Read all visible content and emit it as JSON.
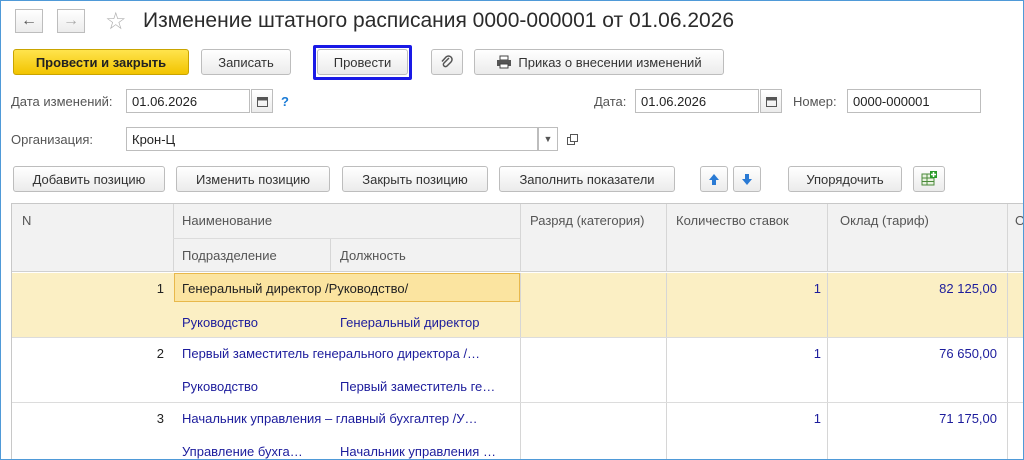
{
  "window": {
    "title": "Изменение штатного расписания 0000-000001 от 01.06.2026",
    "nav_back": "←",
    "nav_forward": "→",
    "favorite": "☆"
  },
  "toolbar": {
    "post_and_close": "Провести и закрыть",
    "save": "Записать",
    "post": "Провести",
    "order": "Приказ о внесении изменений"
  },
  "form": {
    "change_date_label": "Дата изменений:",
    "change_date": "01.06.2026",
    "help": "?",
    "date_label": "Дата:",
    "date": "01.06.2026",
    "number_label": "Номер:",
    "number": "0000-000001",
    "org_label": "Организация:",
    "org": "Крон-Ц"
  },
  "table_toolbar": {
    "add": "Добавить позицию",
    "edit": "Изменить позицию",
    "close": "Закрыть позицию",
    "fill": "Заполнить показатели",
    "sort": "Упорядочить"
  },
  "table": {
    "headers": {
      "n": "N",
      "name": "Наименование",
      "division": "Подразделение",
      "position": "Должность",
      "grade": "Разряд (категория)",
      "rates": "Количество ставок",
      "salary": "Оклад (тариф)",
      "extra": "О"
    },
    "rows": [
      {
        "n": "1",
        "name": "Генеральный директор /Руководство/",
        "division": "Руководство",
        "position": "Генеральный директор",
        "rates": "1",
        "salary": "82 125,00"
      },
      {
        "n": "2",
        "name": "Первый заместитель генерального директора /…",
        "division": "Руководство",
        "position": "Первый заместитель ге…",
        "rates": "1",
        "salary": "76 650,00"
      },
      {
        "n": "3",
        "name": "Начальник управления – главный бухгалтер /У…",
        "division": "Управление бухга…",
        "position": "Начальник управления …",
        "rates": "1",
        "salary": "71 175,00"
      }
    ]
  },
  "colors": {
    "primary": "#f2c400",
    "selection": "#fbefc4",
    "focus": "#1a1ae6",
    "link": "#1c1c9c"
  }
}
